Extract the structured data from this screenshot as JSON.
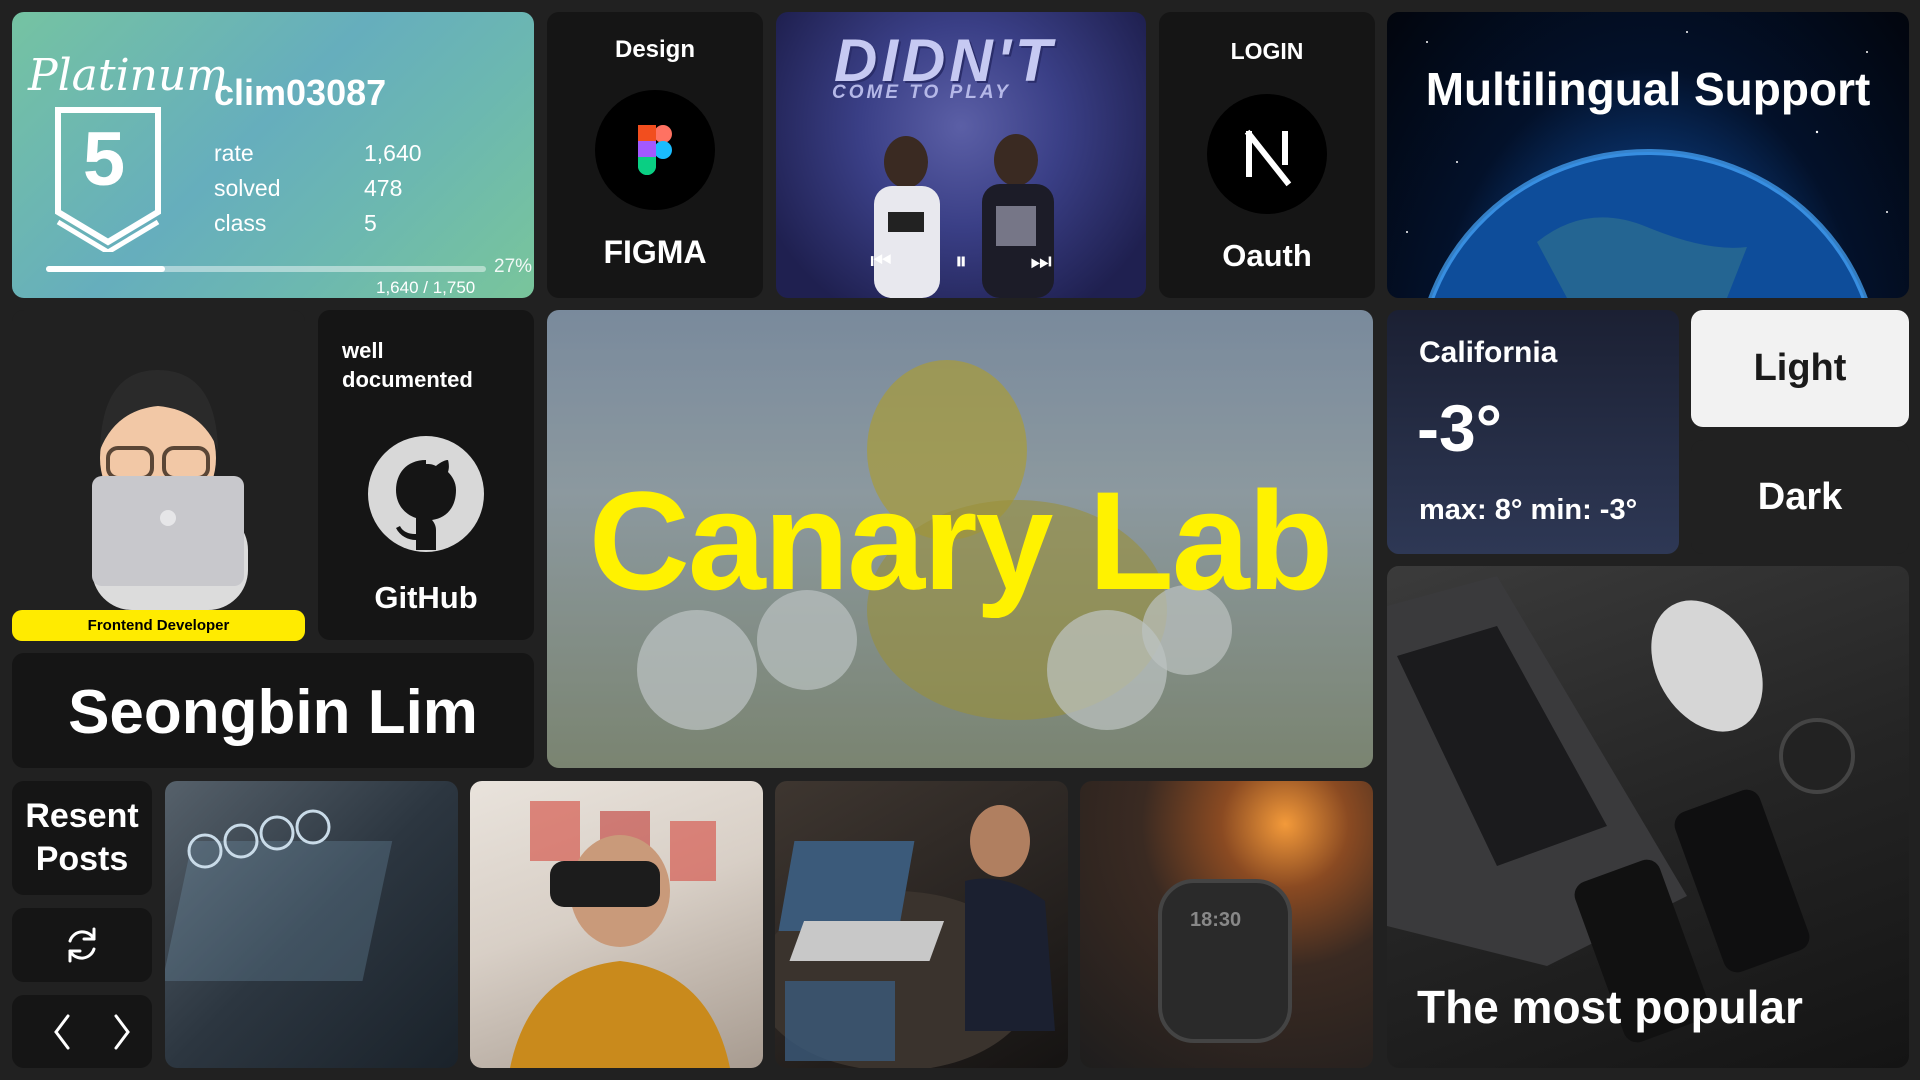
{
  "solved": {
    "tier_name": "Platinum",
    "tier_number": "5",
    "handle": "clim03087",
    "stats": [
      {
        "label": "rate",
        "value": "1,640"
      },
      {
        "label": "solved",
        "value": "478"
      },
      {
        "label": "class",
        "value": "5"
      }
    ],
    "progress_fraction": 0.27,
    "progress_percent": "27%",
    "progress_text": "1,640 / 1,750"
  },
  "figma": {
    "heading": "Design",
    "label": "FIGMA",
    "icon": "figma-logo-icon"
  },
  "music": {
    "album_title": "DIDN'T",
    "album_subtitle": "COME TO PLAY",
    "controls": {
      "prev": "⏮",
      "pause": "⏸",
      "next": "⏭"
    }
  },
  "login": {
    "heading": "LOGIN",
    "label": "Oauth",
    "icon": "nextjs-logo-icon"
  },
  "multilingual": {
    "title": "Multilingual Support"
  },
  "profile": {
    "role": "Frontend Developer",
    "name": "Seongbin Lim"
  },
  "github": {
    "tagline_line1": "well",
    "tagline_line2": "documented",
    "label": "GitHub",
    "icon": "github-logo-icon"
  },
  "hero": {
    "title": "Canary Lab"
  },
  "weather": {
    "city": "California",
    "temperature": "-3°",
    "range": "max: 8° min: -3°"
  },
  "theme": {
    "light_label": "Light",
    "dark_label": "Dark"
  },
  "popular": {
    "title": "The most popular"
  },
  "recent": {
    "label_line1": "Resent",
    "label_line2": "Posts",
    "refresh_icon": "refresh-icon",
    "prev_icon": "chevron-left-icon",
    "next_icon": "chevron-right-icon",
    "watch_time": "18:30"
  },
  "colors": {
    "accent_yellow": "#ffeb00",
    "tile_dark": "#151515",
    "background": "#212121"
  }
}
